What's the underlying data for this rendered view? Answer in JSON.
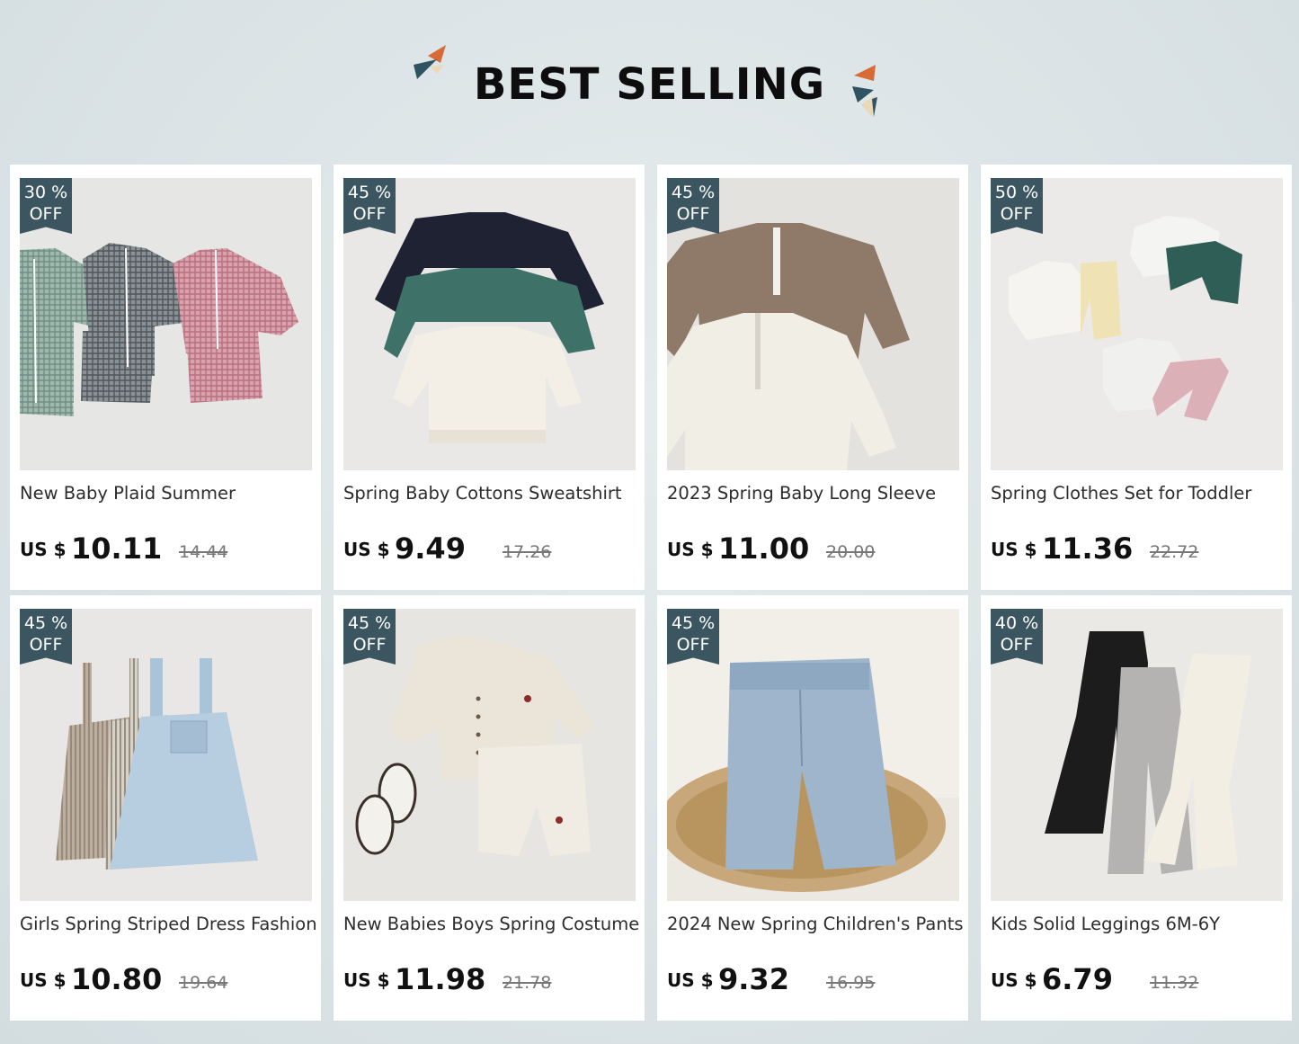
{
  "header": {
    "title": "BEST SELLING"
  },
  "colors": {
    "badge": "#3b5660",
    "deco_orange": "#d86a36",
    "deco_teal": "#2f5360",
    "deco_light": "#e9d9b8"
  },
  "products": [
    {
      "discount_value": "30 %",
      "discount_label": "OFF",
      "name": "New Baby Plaid Summer",
      "currency": "US $",
      "price": "10.11",
      "original_price": "14.44",
      "image_icon": "plaid-set-photo"
    },
    {
      "discount_value": "45 %",
      "discount_label": "OFF",
      "name": "Spring Baby Cottons Sweatshirt",
      "currency": "US $",
      "price": "9.49",
      "original_price": "17.26",
      "image_icon": "sweatshirt-photo"
    },
    {
      "discount_value": "45 %",
      "discount_label": "OFF",
      "name": "2023 Spring Baby Long Sleeve",
      "currency": "US $",
      "price": "11.00",
      "original_price": "20.00",
      "image_icon": "half-zip-photo"
    },
    {
      "discount_value": "50 %",
      "discount_label": "OFF",
      "name": "Spring Clothes Set for Toddler",
      "currency": "US $",
      "price": "11.36",
      "original_price": "22.72",
      "image_icon": "clothes-set-photo"
    },
    {
      "discount_value": "45 %",
      "discount_label": "OFF",
      "name": "Girls Spring Striped Dress Fashion",
      "currency": "US $",
      "price": "10.80",
      "original_price": "19.64",
      "image_icon": "overall-dress-photo"
    },
    {
      "discount_value": "45 %",
      "discount_label": "OFF",
      "name": "New Babies Boys Spring Costume",
      "currency": "US $",
      "price": "11.98",
      "original_price": "21.78",
      "image_icon": "cardigan-set-photo"
    },
    {
      "discount_value": "45 %",
      "discount_label": "OFF",
      "name": "2024 New Spring Children's Pants",
      "currency": "US $",
      "price": "9.32",
      "original_price": "16.95",
      "image_icon": "jeans-photo"
    },
    {
      "discount_value": "40 %",
      "discount_label": "OFF",
      "name": "Kids Solid Leggings 6M-6Y",
      "currency": "US $",
      "price": "6.79",
      "original_price": "11.32",
      "image_icon": "flare-leggings-photo"
    }
  ]
}
